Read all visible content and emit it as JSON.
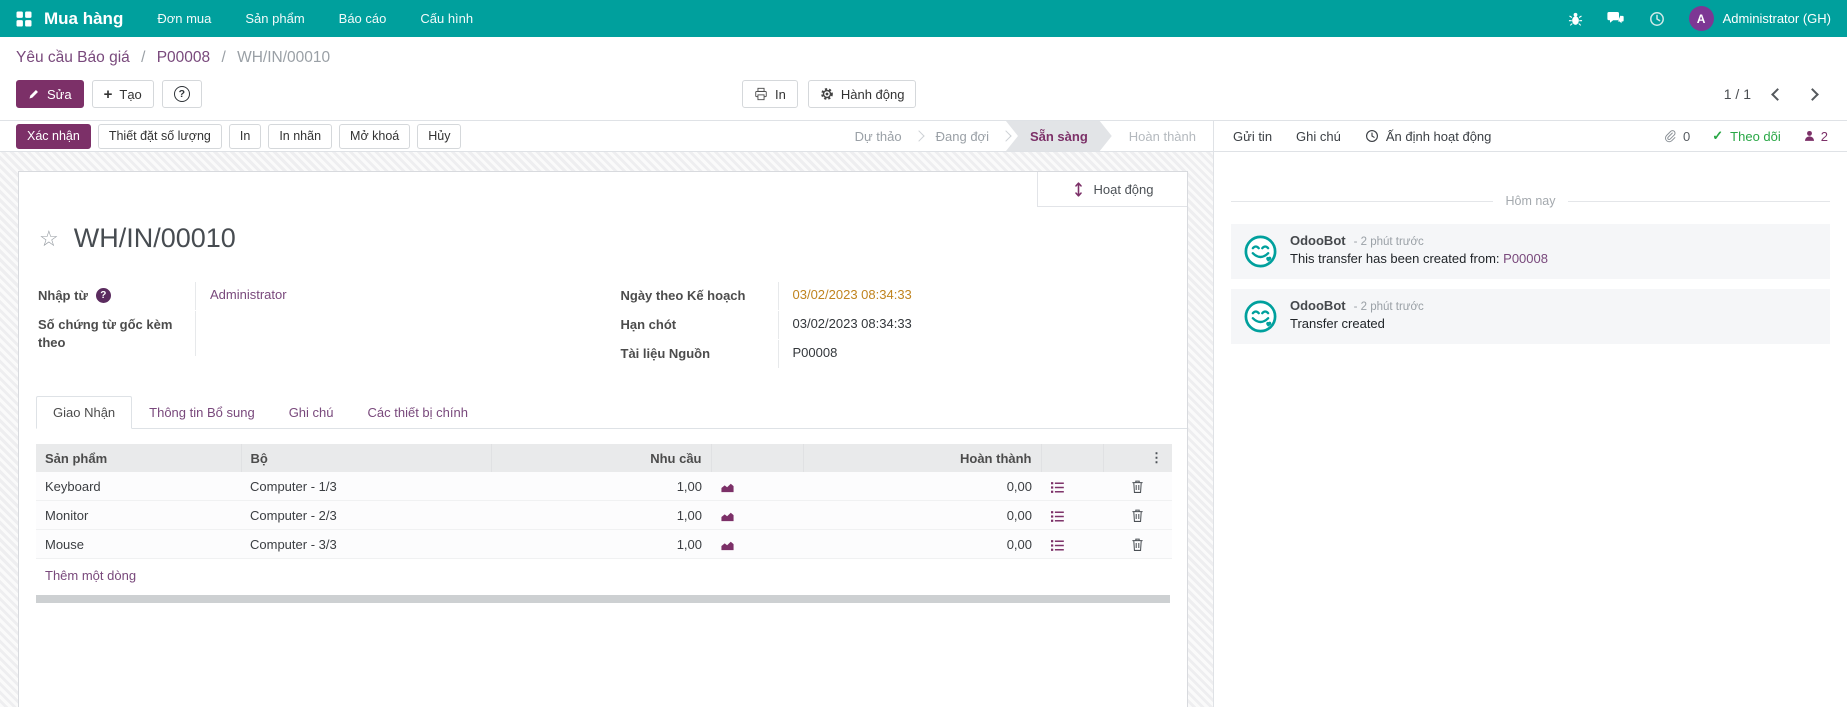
{
  "colors": {
    "navbar_bg": "#00A09D",
    "primary": "#7C3068",
    "link": "#79497C",
    "date_highlight": "#C0841F",
    "follow_green": "#28A745",
    "avatar_bg": "#7D3794",
    "bot_teal": "#00A09D"
  },
  "navbar": {
    "brand": "Mua hàng",
    "menus": [
      {
        "label": "Đơn mua"
      },
      {
        "label": "Sản phẩm"
      },
      {
        "label": "Báo cáo"
      },
      {
        "label": "Cấu hình"
      }
    ],
    "user_initial": "A",
    "user_name": "Administrator (GH)"
  },
  "breadcrumb": {
    "links": [
      {
        "label": "Yêu cầu Báo giá"
      },
      {
        "label": "P00008"
      }
    ],
    "separator": "/",
    "current": "WH/IN/00010"
  },
  "control": {
    "edit": "Sửa",
    "create": "Tạo",
    "print": "In",
    "action": "Hành động",
    "pager": "1 / 1"
  },
  "statusbar": {
    "buttons": [
      {
        "label": "Xác nhận"
      },
      {
        "label": "Thiết đặt số lượng"
      },
      {
        "label": "In"
      },
      {
        "label": "In nhãn"
      },
      {
        "label": "Mở khoá"
      },
      {
        "label": "Hủy"
      }
    ],
    "steps": [
      {
        "label": "Dự thảo"
      },
      {
        "label": "Đang đợi"
      },
      {
        "label": "Sẵn sàng"
      },
      {
        "label": "Hoàn thành"
      }
    ]
  },
  "sheet": {
    "stat_button": "Hoạt động",
    "title": "WH/IN/00010",
    "fields": {
      "receive_from_label": "Nhập từ",
      "receive_from_value": "Administrator",
      "source_doc_label": "Số chứng từ gốc kèm theo",
      "source_doc_value": "",
      "scheduled_label": "Ngày theo Kế hoạch",
      "scheduled_value": "03/02/2023 08:34:33",
      "deadline_label": "Hạn chót",
      "deadline_value": "03/02/2023 08:34:33",
      "source_label": "Tài liệu Nguồn",
      "source_value": "P00008"
    },
    "tabs": [
      {
        "label": "Giao Nhận"
      },
      {
        "label": "Thông tin Bổ sung"
      },
      {
        "label": "Ghi chú"
      },
      {
        "label": "Các thiết bị chính"
      }
    ],
    "table": {
      "headers": {
        "product": "Sản phẩm",
        "bo": "Bộ",
        "demand": "Nhu cầu",
        "done": "Hoàn thành"
      },
      "rows": [
        {
          "product": "Keyboard",
          "bo": "Computer - 1/3",
          "demand": "1,00",
          "done": "0,00"
        },
        {
          "product": "Monitor",
          "bo": "Computer - 2/3",
          "demand": "1,00",
          "done": "0,00"
        },
        {
          "product": "Mouse",
          "bo": "Computer - 3/3",
          "demand": "1,00",
          "done": "0,00"
        }
      ],
      "add_line": "Thêm một dòng"
    }
  },
  "chatter": {
    "send": "Gửi tin",
    "log_note": "Ghi chú",
    "schedule_activity": "Ấn định hoạt động",
    "attachment_count": "0",
    "follow": "Theo dõi",
    "follower_count": "2",
    "date_divider": "Hôm nay",
    "messages": [
      {
        "author": "OdooBot",
        "time": "- 2 phút trước",
        "text": "This transfer has been created from: ",
        "link": "P00008"
      },
      {
        "author": "OdooBot",
        "time": "- 2 phút trước",
        "text": "Transfer created",
        "link": ""
      }
    ]
  }
}
